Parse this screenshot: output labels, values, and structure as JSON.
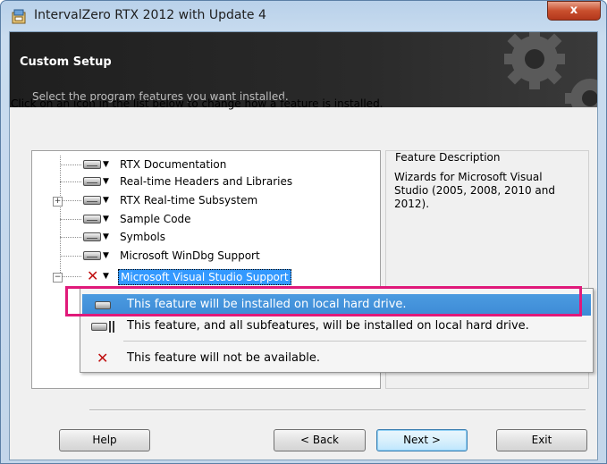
{
  "window": {
    "title": "IntervalZero RTX 2012 with Update 4",
    "close_label": "x"
  },
  "banner": {
    "title": "Custom Setup",
    "subtitle": "Select the program features you want installed."
  },
  "instruction": "Click on an icon in the list below to change how a feature is installed.",
  "features": [
    {
      "label": "RTX Documentation",
      "icon": "drive-icon",
      "expandable": false
    },
    {
      "label": "Real-time Headers and Libraries",
      "icon": "drive-icon",
      "expandable": false
    },
    {
      "label": "RTX Real-time Subsystem",
      "icon": "drive-icon",
      "expandable": true
    },
    {
      "label": "Sample Code",
      "icon": "drive-icon",
      "expandable": false
    },
    {
      "label": "Symbols",
      "icon": "drive-icon",
      "expandable": false
    },
    {
      "label": "Microsoft WinDbg Support",
      "icon": "drive-icon",
      "expandable": false
    },
    {
      "label": "Microsoft Visual Studio Support",
      "icon": "x-icon",
      "expandable": true,
      "selected": true
    }
  ],
  "feature_description": {
    "heading": "Feature Description",
    "text": "Wizards for Microsoft Visual Studio (2005, 2008, 2010 and 2012)."
  },
  "menu": {
    "items": [
      {
        "label": "This feature will be installed on local hard drive.",
        "icon": "drive-icon",
        "highlighted": true
      },
      {
        "label": "This feature, and all subfeatures, will be installed on local hard drive.",
        "icon": "drive-all-icon"
      },
      {
        "label": "This feature will not be available.",
        "icon": "x-icon"
      }
    ]
  },
  "buttons": {
    "help": "Help",
    "back": "< Back",
    "next": "Next >",
    "exit": "Exit"
  },
  "colors": {
    "highlight_border": "#e0197a",
    "selection": "#3399ff",
    "close_button": "#c94f2e"
  }
}
